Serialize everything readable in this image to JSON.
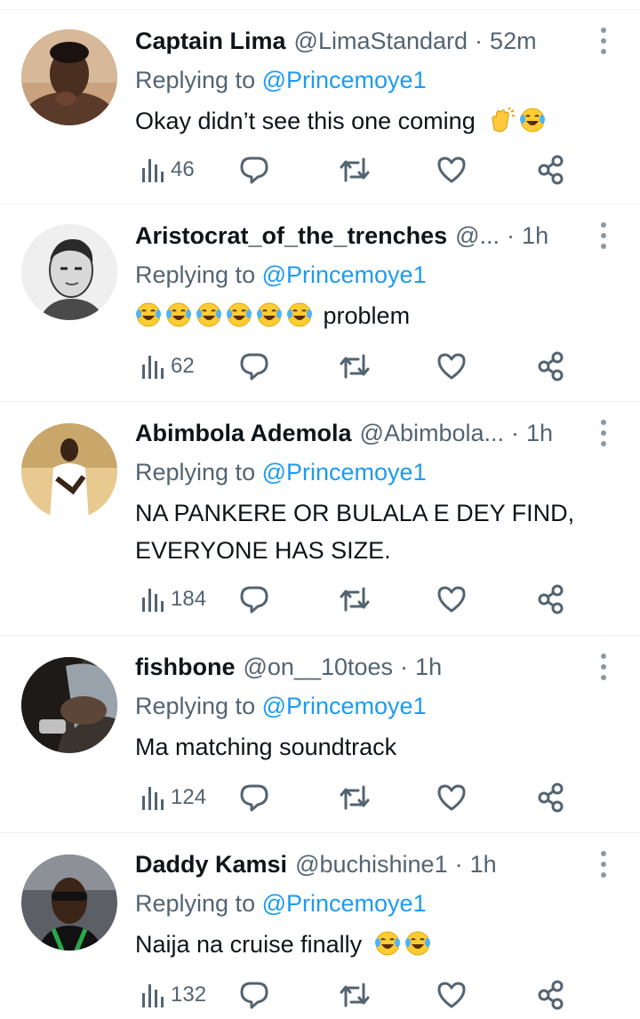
{
  "tweets": [
    {
      "name": "Captain Lima",
      "handle": "@LimaStandard",
      "time": "52m",
      "reply_label": "Replying to",
      "reply_to": "@Princemoye1",
      "text_lines": [
        "Okay didn’t see this one coming"
      ],
      "emojis": [
        "clapping-hands-emoji",
        "laughing-tears-emoji"
      ],
      "views": "46"
    },
    {
      "name": "Aristocrat_of_the_trenches",
      "handle": "@...",
      "time": "1h",
      "reply_label": "Replying to",
      "reply_to": "@Princemoye1",
      "text_lines": [
        "problem"
      ],
      "emojis": [
        "laughing-tears-emoji",
        "laughing-tears-emoji",
        "laughing-tears-emoji",
        "laughing-tears-emoji",
        "laughing-tears-emoji",
        "laughing-tears-emoji"
      ],
      "views": "62"
    },
    {
      "name": "Abimbola Ademola",
      "handle": "@Abimbola...",
      "time": "1h",
      "reply_label": "Replying to",
      "reply_to": "@Princemoye1",
      "text_lines": [
        "NA PANKERE OR BULALA E DEY FIND,",
        "EVERYONE HAS SIZE."
      ],
      "emojis": [],
      "views": "184"
    },
    {
      "name": "fishbone",
      "handle": "@on__10toes",
      "time": "1h",
      "reply_label": "Replying to",
      "reply_to": "@Princemoye1",
      "text_lines": [
        "Ma matching soundtrack"
      ],
      "emojis": [],
      "views": "124"
    },
    {
      "name": "Daddy Kamsi",
      "handle": "@buchishine1",
      "time": "1h",
      "reply_label": "Replying to",
      "reply_to": "@Princemoye1",
      "text_lines": [
        "Naija na cruise finally"
      ],
      "emojis": [
        "laughing-tears-emoji",
        "laughing-tears-emoji"
      ],
      "views": "132"
    }
  ],
  "separator": "·",
  "colors": {
    "link": "#1d9bf0",
    "secondary_text": "#536471",
    "primary_text": "#0f1419",
    "divider": "#eff3f4"
  }
}
